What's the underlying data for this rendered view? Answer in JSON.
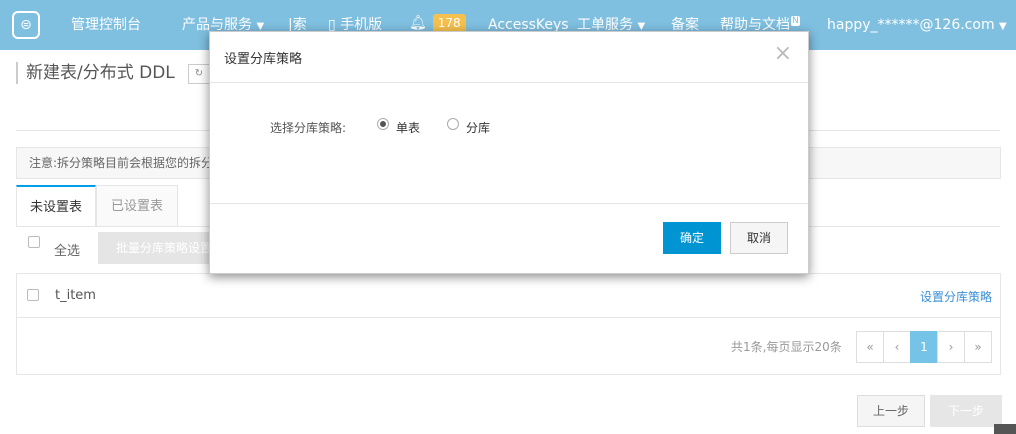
{
  "nav": {
    "logo_icon": "aliyun-logo-icon",
    "console": "管理控制台",
    "products": "产品与服务",
    "search_fragment": "索",
    "mobile": "手机版",
    "bell_count": "178",
    "accesskeys": "AccessKeys",
    "tickets": "工单服务",
    "beian": "备案",
    "help": "帮助与文档",
    "help_badge": "N",
    "account": "happy_******@126.com"
  },
  "page": {
    "title": "新建表/分布式 DDL",
    "notice": "注意:拆分策略目前会根据您的拆分"
  },
  "tabs": [
    "未设置表",
    "已设置表"
  ],
  "toolbar": {
    "select_all": "全选",
    "batch_button": "批量分库策略设置"
  },
  "table": {
    "rows": [
      {
        "name": "t_item",
        "action": "设置分库策略"
      }
    ]
  },
  "pagination": {
    "info": "共1条,每页显示20条",
    "first": "«",
    "prev": "‹",
    "current": "1",
    "next": "›",
    "last": "»"
  },
  "footer": {
    "prev_step": "上一步",
    "next_step": "下一步"
  },
  "modal": {
    "title": "设置分库策略",
    "close": "×",
    "label": "选择分库策略:",
    "options": [
      {
        "label": "单表",
        "selected": true
      },
      {
        "label": "分库",
        "selected": false
      }
    ],
    "ok": "确定",
    "cancel": "取消"
  },
  "colors": {
    "nav_bg": "#7fbfe0",
    "primary": "#0094d2",
    "link": "#3a8fd6",
    "badge": "#f5c04d"
  }
}
